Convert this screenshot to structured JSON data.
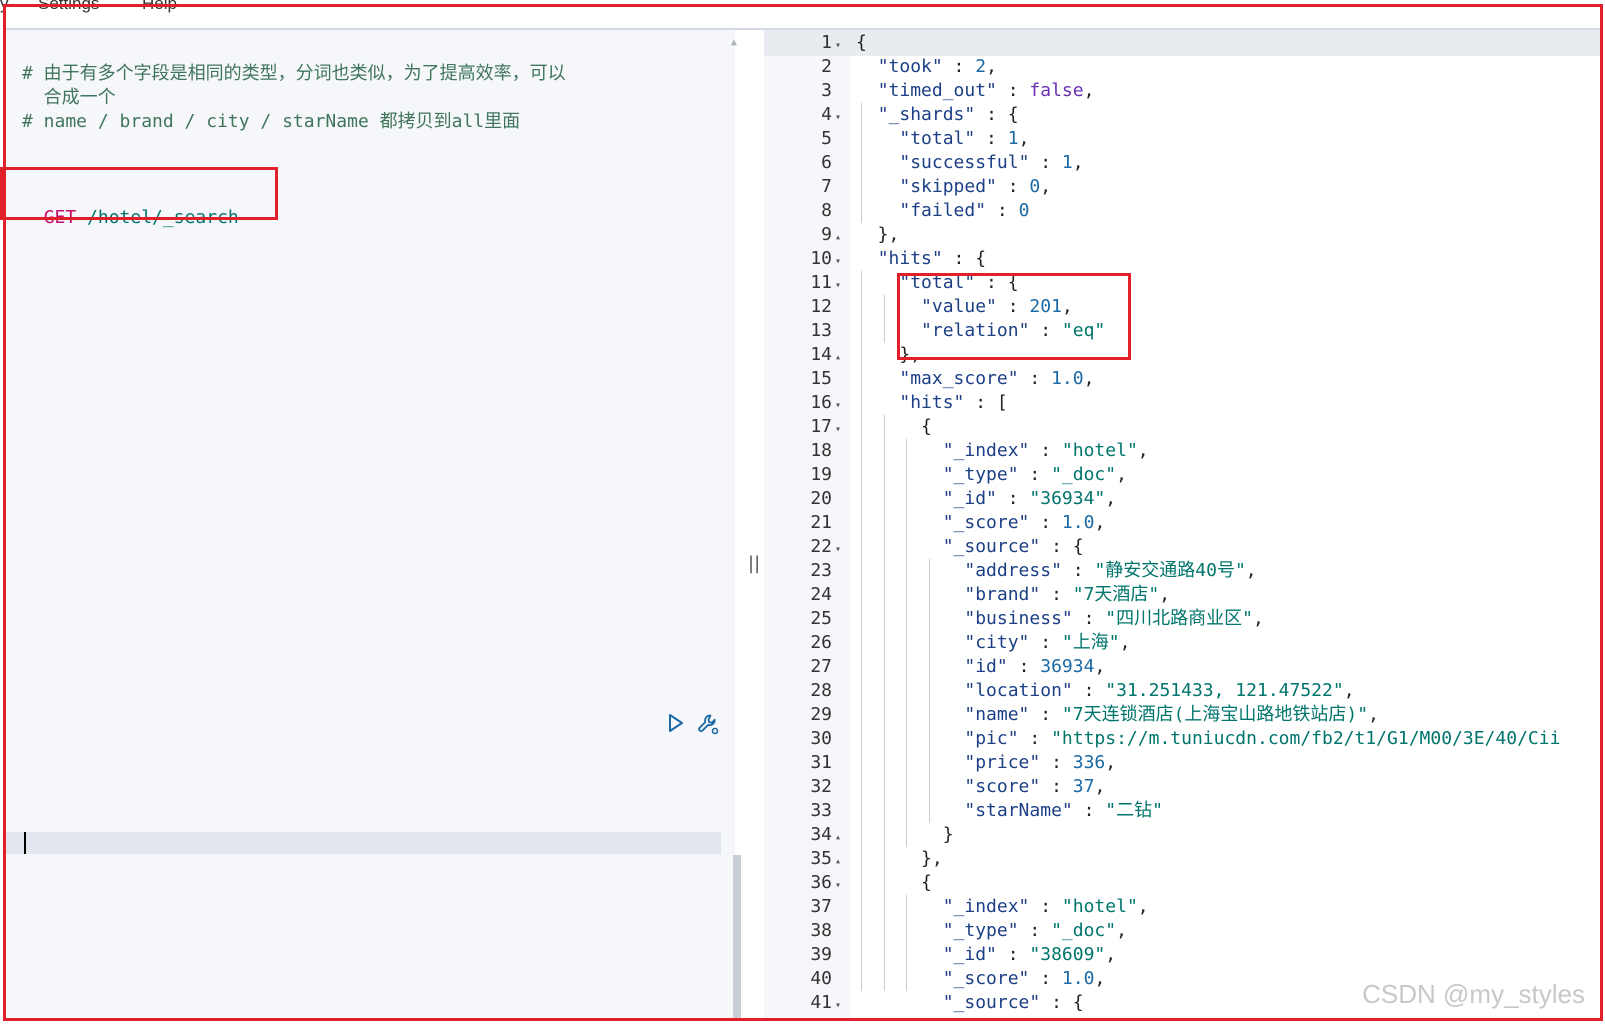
{
  "menubar": {
    "items": [
      "y",
      "Settings",
      "Help"
    ]
  },
  "editor": {
    "comment_line1": "# 由于有多个字段是相同的类型，分词也类似，为了提高效率，可以",
    "comment_line1b": "  合成一个",
    "comment_line2": "# name / brand / city / starName 都拷贝到all里面",
    "request_method": "GET",
    "request_path": " /hotel/_search"
  },
  "toolbar": {
    "run_icon": "play-icon",
    "settings_icon": "wrench-icon"
  },
  "output": {
    "line_numbers": [
      "1",
      "2",
      "3",
      "4",
      "5",
      "6",
      "7",
      "8",
      "9",
      "10",
      "11",
      "12",
      "13",
      "14",
      "15",
      "16",
      "17",
      "18",
      "19",
      "20",
      "21",
      "22",
      "23",
      "24",
      "25",
      "26",
      "27",
      "28",
      "29",
      "30",
      "31",
      "32",
      "33",
      "34",
      "35",
      "36",
      "37",
      "38",
      "39",
      "40",
      "41"
    ],
    "folds": [
      "▾",
      "",
      "",
      "▾",
      "",
      "",
      "",
      "",
      "▴",
      "▾",
      "▾",
      "",
      "",
      "▴",
      "",
      "▾",
      "▾",
      "",
      "",
      "",
      "",
      "▾",
      "",
      "",
      "",
      "",
      "",
      "",
      "",
      "",
      "",
      "",
      "",
      "▴",
      "▴",
      "▾",
      "",
      "",
      "",
      "",
      "▾"
    ],
    "lines": [
      [
        {
          "c": "p",
          "t": "{"
        }
      ],
      [
        {
          "c": "p",
          "t": "  "
        },
        {
          "c": "k",
          "t": "\"took\""
        },
        {
          "c": "p",
          "t": " : "
        },
        {
          "c": "n",
          "t": "2"
        },
        {
          "c": "p",
          "t": ","
        }
      ],
      [
        {
          "c": "p",
          "t": "  "
        },
        {
          "c": "k",
          "t": "\"timed_out\""
        },
        {
          "c": "p",
          "t": " : "
        },
        {
          "c": "b",
          "t": "false"
        },
        {
          "c": "p",
          "t": ","
        }
      ],
      [
        {
          "c": "p",
          "t": "  "
        },
        {
          "c": "k",
          "t": "\"_shards\""
        },
        {
          "c": "p",
          "t": " : {"
        }
      ],
      [
        {
          "c": "p",
          "t": "    "
        },
        {
          "c": "k",
          "t": "\"total\""
        },
        {
          "c": "p",
          "t": " : "
        },
        {
          "c": "n",
          "t": "1"
        },
        {
          "c": "p",
          "t": ","
        }
      ],
      [
        {
          "c": "p",
          "t": "    "
        },
        {
          "c": "k",
          "t": "\"successful\""
        },
        {
          "c": "p",
          "t": " : "
        },
        {
          "c": "n",
          "t": "1"
        },
        {
          "c": "p",
          "t": ","
        }
      ],
      [
        {
          "c": "p",
          "t": "    "
        },
        {
          "c": "k",
          "t": "\"skipped\""
        },
        {
          "c": "p",
          "t": " : "
        },
        {
          "c": "n",
          "t": "0"
        },
        {
          "c": "p",
          "t": ","
        }
      ],
      [
        {
          "c": "p",
          "t": "    "
        },
        {
          "c": "k",
          "t": "\"failed\""
        },
        {
          "c": "p",
          "t": " : "
        },
        {
          "c": "n",
          "t": "0"
        }
      ],
      [
        {
          "c": "p",
          "t": "  },"
        }
      ],
      [
        {
          "c": "p",
          "t": "  "
        },
        {
          "c": "k",
          "t": "\"hits\""
        },
        {
          "c": "p",
          "t": " : {"
        }
      ],
      [
        {
          "c": "p",
          "t": "    "
        },
        {
          "c": "k",
          "t": "\"total\""
        },
        {
          "c": "p",
          "t": " : {"
        }
      ],
      [
        {
          "c": "p",
          "t": "      "
        },
        {
          "c": "k",
          "t": "\"value\""
        },
        {
          "c": "p",
          "t": " : "
        },
        {
          "c": "n",
          "t": "201"
        },
        {
          "c": "p",
          "t": ","
        }
      ],
      [
        {
          "c": "p",
          "t": "      "
        },
        {
          "c": "k",
          "t": "\"relation\""
        },
        {
          "c": "p",
          "t": " : "
        },
        {
          "c": "s",
          "t": "\"eq\""
        }
      ],
      [
        {
          "c": "p",
          "t": "    },"
        }
      ],
      [
        {
          "c": "p",
          "t": "    "
        },
        {
          "c": "k",
          "t": "\"max_score\""
        },
        {
          "c": "p",
          "t": " : "
        },
        {
          "c": "n",
          "t": "1.0"
        },
        {
          "c": "p",
          "t": ","
        }
      ],
      [
        {
          "c": "p",
          "t": "    "
        },
        {
          "c": "k",
          "t": "\"hits\""
        },
        {
          "c": "p",
          "t": " : ["
        }
      ],
      [
        {
          "c": "p",
          "t": "      {"
        }
      ],
      [
        {
          "c": "p",
          "t": "        "
        },
        {
          "c": "k",
          "t": "\"_index\""
        },
        {
          "c": "p",
          "t": " : "
        },
        {
          "c": "s",
          "t": "\"hotel\""
        },
        {
          "c": "p",
          "t": ","
        }
      ],
      [
        {
          "c": "p",
          "t": "        "
        },
        {
          "c": "k",
          "t": "\"_type\""
        },
        {
          "c": "p",
          "t": " : "
        },
        {
          "c": "s",
          "t": "\"_doc\""
        },
        {
          "c": "p",
          "t": ","
        }
      ],
      [
        {
          "c": "p",
          "t": "        "
        },
        {
          "c": "k",
          "t": "\"_id\""
        },
        {
          "c": "p",
          "t": " : "
        },
        {
          "c": "s",
          "t": "\"36934\""
        },
        {
          "c": "p",
          "t": ","
        }
      ],
      [
        {
          "c": "p",
          "t": "        "
        },
        {
          "c": "k",
          "t": "\"_score\""
        },
        {
          "c": "p",
          "t": " : "
        },
        {
          "c": "n",
          "t": "1.0"
        },
        {
          "c": "p",
          "t": ","
        }
      ],
      [
        {
          "c": "p",
          "t": "        "
        },
        {
          "c": "k",
          "t": "\"_source\""
        },
        {
          "c": "p",
          "t": " : {"
        }
      ],
      [
        {
          "c": "p",
          "t": "          "
        },
        {
          "c": "k",
          "t": "\"address\""
        },
        {
          "c": "p",
          "t": " : "
        },
        {
          "c": "s",
          "t": "\"静安交通路40号\""
        },
        {
          "c": "p",
          "t": ","
        }
      ],
      [
        {
          "c": "p",
          "t": "          "
        },
        {
          "c": "k",
          "t": "\"brand\""
        },
        {
          "c": "p",
          "t": " : "
        },
        {
          "c": "s",
          "t": "\"7天酒店\""
        },
        {
          "c": "p",
          "t": ","
        }
      ],
      [
        {
          "c": "p",
          "t": "          "
        },
        {
          "c": "k",
          "t": "\"business\""
        },
        {
          "c": "p",
          "t": " : "
        },
        {
          "c": "s",
          "t": "\"四川北路商业区\""
        },
        {
          "c": "p",
          "t": ","
        }
      ],
      [
        {
          "c": "p",
          "t": "          "
        },
        {
          "c": "k",
          "t": "\"city\""
        },
        {
          "c": "p",
          "t": " : "
        },
        {
          "c": "s",
          "t": "\"上海\""
        },
        {
          "c": "p",
          "t": ","
        }
      ],
      [
        {
          "c": "p",
          "t": "          "
        },
        {
          "c": "k",
          "t": "\"id\""
        },
        {
          "c": "p",
          "t": " : "
        },
        {
          "c": "n",
          "t": "36934"
        },
        {
          "c": "p",
          "t": ","
        }
      ],
      [
        {
          "c": "p",
          "t": "          "
        },
        {
          "c": "k",
          "t": "\"location\""
        },
        {
          "c": "p",
          "t": " : "
        },
        {
          "c": "s",
          "t": "\"31.251433, 121.47522\""
        },
        {
          "c": "p",
          "t": ","
        }
      ],
      [
        {
          "c": "p",
          "t": "          "
        },
        {
          "c": "k",
          "t": "\"name\""
        },
        {
          "c": "p",
          "t": " : "
        },
        {
          "c": "s",
          "t": "\"7天连锁酒店(上海宝山路地铁站店)\""
        },
        {
          "c": "p",
          "t": ","
        }
      ],
      [
        {
          "c": "p",
          "t": "          "
        },
        {
          "c": "k",
          "t": "\"pic\""
        },
        {
          "c": "p",
          "t": " : "
        },
        {
          "c": "s",
          "t": "\"https://m.tuniucdn.com/fb2/t1/G1/M00/3E/40/Cii"
        }
      ],
      [
        {
          "c": "p",
          "t": "          "
        },
        {
          "c": "k",
          "t": "\"price\""
        },
        {
          "c": "p",
          "t": " : "
        },
        {
          "c": "n",
          "t": "336"
        },
        {
          "c": "p",
          "t": ","
        }
      ],
      [
        {
          "c": "p",
          "t": "          "
        },
        {
          "c": "k",
          "t": "\"score\""
        },
        {
          "c": "p",
          "t": " : "
        },
        {
          "c": "n",
          "t": "37"
        },
        {
          "c": "p",
          "t": ","
        }
      ],
      [
        {
          "c": "p",
          "t": "          "
        },
        {
          "c": "k",
          "t": "\"starName\""
        },
        {
          "c": "p",
          "t": " : "
        },
        {
          "c": "s",
          "t": "\"二钻\""
        }
      ],
      [
        {
          "c": "p",
          "t": "        }"
        }
      ],
      [
        {
          "c": "p",
          "t": "      },"
        }
      ],
      [
        {
          "c": "p",
          "t": "      {"
        }
      ],
      [
        {
          "c": "p",
          "t": "        "
        },
        {
          "c": "k",
          "t": "\"_index\""
        },
        {
          "c": "p",
          "t": " : "
        },
        {
          "c": "s",
          "t": "\"hotel\""
        },
        {
          "c": "p",
          "t": ","
        }
      ],
      [
        {
          "c": "p",
          "t": "        "
        },
        {
          "c": "k",
          "t": "\"_type\""
        },
        {
          "c": "p",
          "t": " : "
        },
        {
          "c": "s",
          "t": "\"_doc\""
        },
        {
          "c": "p",
          "t": ","
        }
      ],
      [
        {
          "c": "p",
          "t": "        "
        },
        {
          "c": "k",
          "t": "\"_id\""
        },
        {
          "c": "p",
          "t": " : "
        },
        {
          "c": "s",
          "t": "\"38609\""
        },
        {
          "c": "p",
          "t": ","
        }
      ],
      [
        {
          "c": "p",
          "t": "        "
        },
        {
          "c": "k",
          "t": "\"_score\""
        },
        {
          "c": "p",
          "t": " : "
        },
        {
          "c": "n",
          "t": "1.0"
        },
        {
          "c": "p",
          "t": ","
        }
      ],
      [
        {
          "c": "p",
          "t": "        "
        },
        {
          "c": "k",
          "t": "\"_source\""
        },
        {
          "c": "p",
          "t": " : {"
        }
      ]
    ]
  },
  "divider_icon": "||",
  "watermark": "CSDN @my_styles",
  "colors": {
    "highlight_box": "#e0202a",
    "method": "#c80a68",
    "string": "#00756c",
    "key": "#1c3f85",
    "boolean": "#6a2fb4",
    "comment": "#41755c"
  }
}
